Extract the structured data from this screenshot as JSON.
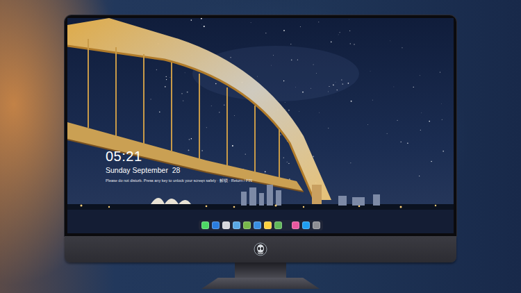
{
  "lock_screen": {
    "time": "05:21",
    "date": "Sunday September  28",
    "notice": "Please do not disturb. Press any key to unlock your screen safely · 解锁 · Return / PIN"
  },
  "dock": {
    "items": [
      {
        "color": "#4cd964"
      },
      {
        "color": "#2a7de1"
      },
      {
        "color": "#d8d8dc"
      },
      {
        "color": "#5aa9e6"
      },
      {
        "color": "#79b84a"
      },
      {
        "color": "#3a8fe3"
      },
      {
        "color": "#ffd23f"
      },
      {
        "color": "#62b85a"
      },
      {
        "color": "#e9589f"
      },
      {
        "color": "#1e9ff2"
      },
      {
        "color": "#8e8e93"
      }
    ]
  }
}
